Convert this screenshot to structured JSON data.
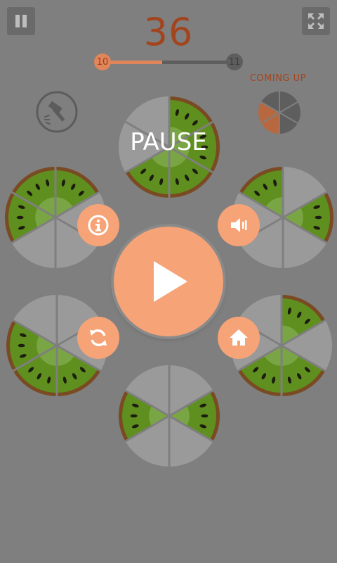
{
  "hud": {
    "score": "36",
    "level_current": "10",
    "level_next": "11",
    "level_progress": 0.45,
    "coming_up_label": "COMING UP"
  },
  "pause_menu": {
    "title": "PAUSE"
  },
  "icons": {
    "pause": "pause-icon",
    "fullscreen": "fullscreen-icon",
    "hammer": "hammer-icon",
    "info": "info-icon",
    "sound": "speaker-icon",
    "restart": "refresh-icon",
    "home": "home-icon",
    "play": "play-icon"
  },
  "colors": {
    "background": "#7f7f7f",
    "accent": "#f5a377",
    "score": "#a2451f",
    "kiwi_flesh": "#5f8f1e",
    "kiwi_skin": "#7a4a22",
    "empty_slice": "#9a9a9a"
  },
  "coming_up": {
    "filled_slices": [
      3,
      4
    ]
  },
  "wheels": [
    {
      "id": "top",
      "filled": [
        0,
        1,
        2,
        3
      ]
    },
    {
      "id": "upper-left",
      "filled": [
        0,
        4,
        5
      ]
    },
    {
      "id": "upper-right",
      "filled": [
        1,
        5
      ]
    },
    {
      "id": "lower-left",
      "filled": [
        2,
        3,
        4
      ]
    },
    {
      "id": "lower-right",
      "filled": [
        0,
        2,
        3
      ]
    },
    {
      "id": "bottom",
      "filled": [
        1,
        4
      ]
    }
  ]
}
